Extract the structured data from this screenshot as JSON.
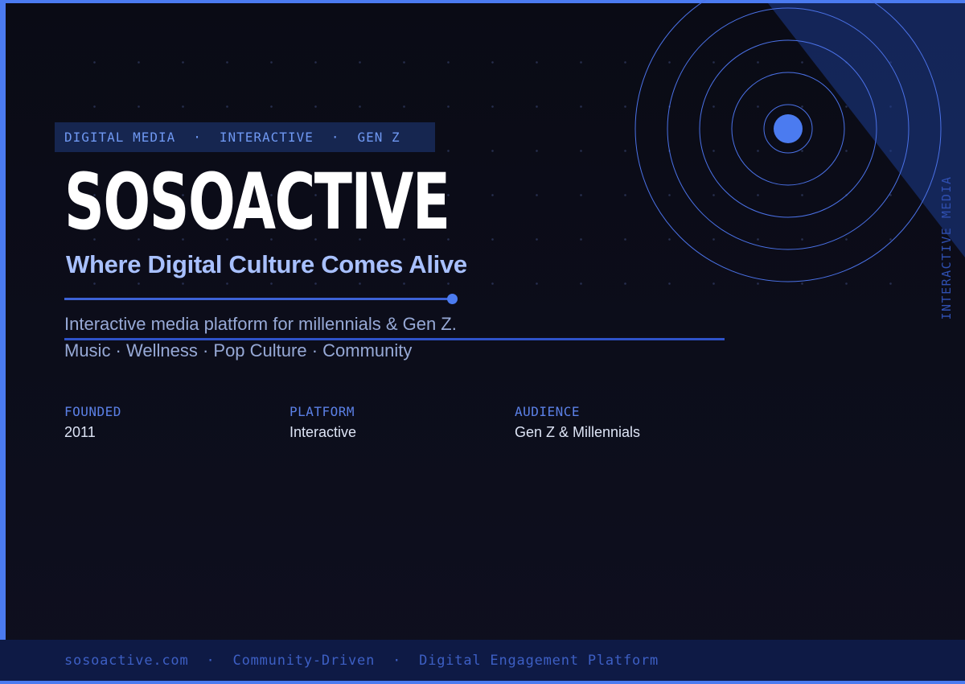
{
  "tags": [
    "DIGITAL MEDIA",
    "INTERACTIVE",
    "GEN Z"
  ],
  "tag_separator": "·",
  "brand": "SOSOACTIVE",
  "tagline": "Where Digital Culture Comes Alive",
  "description": {
    "line1": "Interactive media platform for millennials & Gen Z.",
    "line2": "Music · Wellness · Pop Culture · Community"
  },
  "meta": [
    {
      "label": "FOUNDED",
      "value": "2011"
    },
    {
      "label": "PLATFORM",
      "value": "Interactive"
    },
    {
      "label": "AUDIENCE",
      "value": "Gen Z & Millennials"
    }
  ],
  "side_label": "INTERACTIVE MEDIA",
  "footer": {
    "items": [
      "sosoactive.com",
      "Community-Driven",
      "Digital Engagement Platform"
    ],
    "separator": "·"
  },
  "colors": {
    "background": "#0b0c17",
    "accent": "#4b7bf0",
    "tag_bg": "#162650",
    "footer_bg": "#0e1a45",
    "tagline": "#a8c0ff"
  }
}
